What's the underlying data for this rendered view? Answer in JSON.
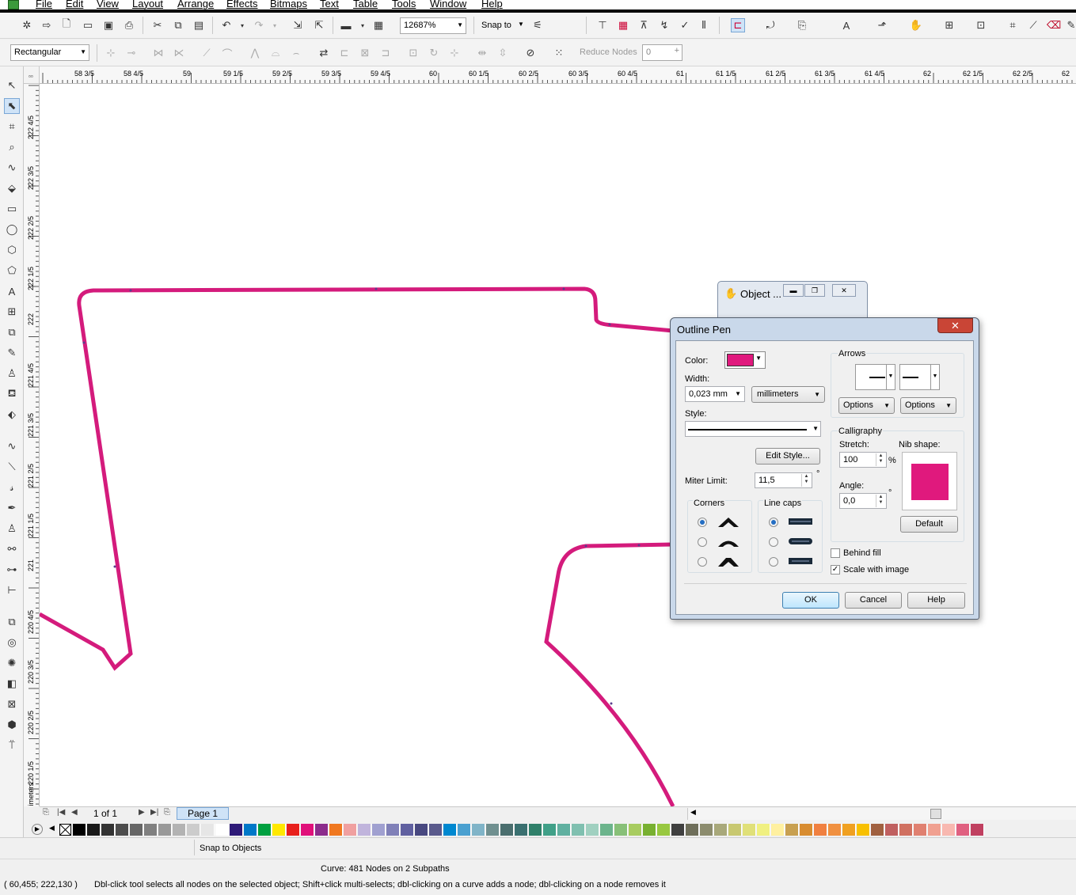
{
  "menu": [
    "File",
    "Edit",
    "View",
    "Layout",
    "Arrange",
    "Effects",
    "Bitmaps",
    "Text",
    "Table",
    "Tools",
    "Window",
    "Help"
  ],
  "toolbar": {
    "zoom": "12687%",
    "snap_to": "Snap to"
  },
  "propertybar": {
    "selection_mode": "Rectangular",
    "reduce_nodes_label": "Reduce Nodes",
    "reduce_nodes_value": "0"
  },
  "rulers": {
    "corner": "▫▫",
    "horizontal": [
      "58  3/5",
      "58  4/5",
      "59",
      "59  1/5",
      "59  2/5",
      "59  3/5",
      "59  4/5",
      "60",
      "60  1/5",
      "60  2/5",
      "60  3/5",
      "60  4/5",
      "61",
      "61  1/5",
      "61  2/5",
      "61  3/5",
      "61  4/5",
      "62",
      "62  1/5",
      "62  2/5",
      "62"
    ],
    "vertical": [
      "222  4/5",
      "222  3/5",
      "222  2/5",
      "222  1/5",
      "222",
      "221  4/5",
      "221  3/5",
      "221  2/5",
      "221  1/5",
      "221",
      "220  4/5",
      "220  3/5",
      "220  2/5",
      "220  1/5",
      "millimeters"
    ]
  },
  "pagenav": {
    "count": "1 of 1",
    "tab": "Page 1"
  },
  "palette": [
    "#000000",
    "#1a1a1a",
    "#333333",
    "#4d4d4d",
    "#666666",
    "#808080",
    "#999999",
    "#b3b3b3",
    "#cccccc",
    "#e6e6e6",
    "#ffffff",
    "#2e1a78",
    "#0078c8",
    "#00a040",
    "#ffe800",
    "#e8201c",
    "#e0107a",
    "#8c2c8c",
    "#f07820",
    "#f0a0a0",
    "#c0b4dc",
    "#a0a0d0",
    "#8080b8",
    "#6060a0",
    "#484880",
    "#5a5a8c",
    "#0088d0",
    "#4aa0d0",
    "#80b4c8",
    "#709090",
    "#4a6e6e",
    "#3a7070",
    "#30806a",
    "#40a088",
    "#60b0a0",
    "#80c0b0",
    "#a0d0c0",
    "#6cb48c",
    "#88c078",
    "#a8cc60",
    "#78b030",
    "#98c840",
    "#404040",
    "#6e6e5a",
    "#8c8c6e",
    "#a8a87a",
    "#c8c870",
    "#e0e078",
    "#f0f080",
    "#fff0a0",
    "#c8a050",
    "#d88c30",
    "#f08040",
    "#f09040",
    "#f0a020",
    "#f8c000",
    "#a06040",
    "#c06060",
    "#d07060",
    "#e08070",
    "#f0a090",
    "#f8b8b0",
    "#e06080",
    "#c04060"
  ],
  "status": {
    "snap": "Snap to Objects",
    "curve_info": "Curve: 481 Nodes on 2 Subpaths",
    "coords": "( 60,455; 222,130 )",
    "hint": "Dbl-click tool selects all nodes on the selected object; Shift+click multi-selects; dbl-clicking on a curve adds a node; dbl-clicking on a node removes it"
  },
  "object_window": {
    "title": "Object ..."
  },
  "dialog": {
    "title": "Outline Pen",
    "color_label": "Color:",
    "color_value": "#e0197d",
    "width_label": "Width:",
    "width_value": "0,023 mm",
    "units_value": "millimeters",
    "style_label": "Style:",
    "edit_style": "Edit Style...",
    "miter_label": "Miter Limit:",
    "miter_value": "11,5",
    "degree": "°",
    "corners_label": "Corners",
    "linecaps_label": "Line caps",
    "arrows_label": "Arrows",
    "options1": "Options",
    "options2": "Options",
    "calligraphy_label": "Calligraphy",
    "stretch_label": "Stretch:",
    "stretch_value": "100",
    "percent": "%",
    "nib_label": "Nib shape:",
    "angle_label": "Angle:",
    "angle_value": "0,0",
    "default_btn": "Default",
    "behind_fill": "Behind fill",
    "scale_image": "Scale with image",
    "ok": "OK",
    "cancel": "Cancel",
    "help": "Help"
  }
}
